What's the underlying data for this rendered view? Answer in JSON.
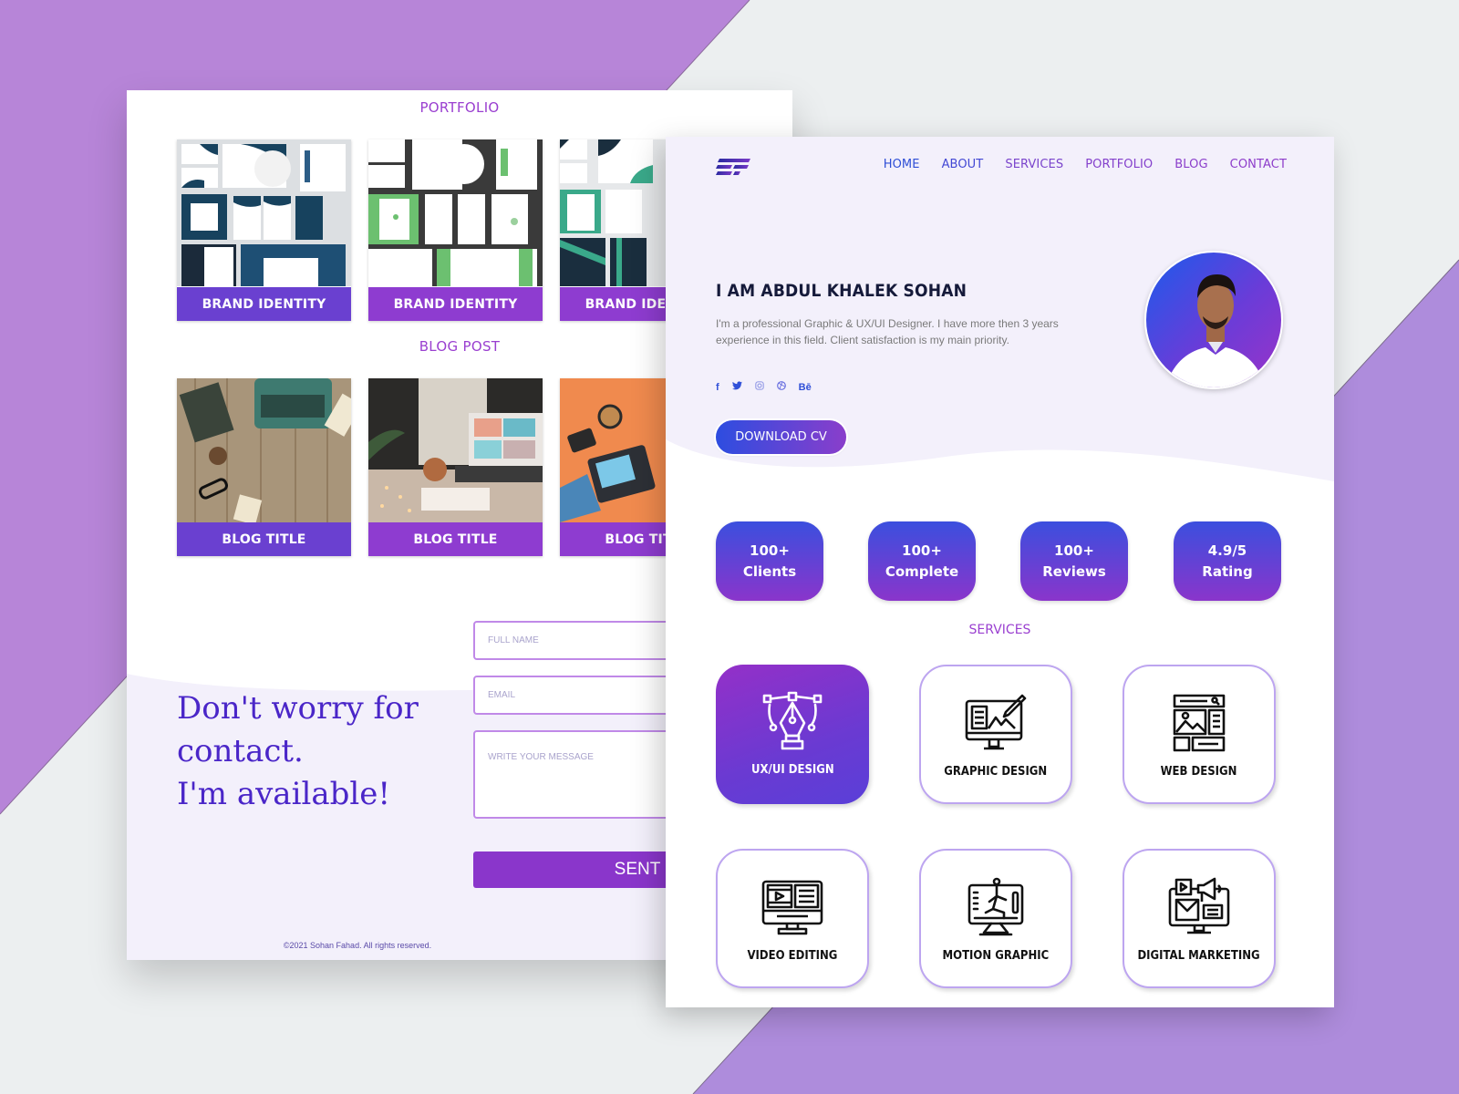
{
  "colors": {
    "background_purple": "#b785d8",
    "background_grey": "#eceff0",
    "accent_purple": "#8a36cb",
    "accent_blue": "#2d4de0",
    "heading_purple": "#9a3fd0",
    "contact_heading": "#4a26c8"
  },
  "left_page": {
    "portfolio": {
      "title": "PORTFOLIO",
      "items": [
        {
          "label": "BRAND IDENTITY",
          "image": "stationery-mockup-navy"
        },
        {
          "label": "BRAND IDENTITY",
          "image": "stationery-mockup-green"
        },
        {
          "label": "BRAND IDENTITY",
          "image": "stationery-mockup-teal"
        }
      ]
    },
    "blog": {
      "title": "BLOG POST",
      "items": [
        {
          "label": "BLOG TITLE",
          "image": "typewriter-desk-photo"
        },
        {
          "label": "BLOG TITLE",
          "image": "laptop-workspace-photo"
        },
        {
          "label": "BLOG TITLE",
          "image": "designer-tablet-illustration"
        }
      ]
    },
    "contact": {
      "heading_line1": "Don't worry for",
      "heading_line2": "contact.",
      "heading_line3": "I'm available!",
      "full_name_placeholder": "FULL NAME",
      "email_placeholder": "EMAIL",
      "message_placeholder": "WRITE YOUR MESSAGE",
      "submit_label": "SENT"
    },
    "footer": "©2021 Sohan Fahad. All rights reserved."
  },
  "right_page": {
    "logo": "SF",
    "nav": [
      {
        "label": "HOME",
        "color": "#2f4fd6"
      },
      {
        "label": "ABOUT",
        "color": "#4348d4"
      },
      {
        "label": "SERVICES",
        "color": "#7a44cc"
      },
      {
        "label": "PORTFOLIO",
        "color": "#8440cc"
      },
      {
        "label": "BLOG",
        "color": "#8a3ecb"
      },
      {
        "label": "CONTACT",
        "color": "#8d3cca"
      }
    ],
    "hero": {
      "name": "I AM ABDUL KHALEK SOHAN",
      "description": "I'm a professional Graphic & UX/UI Designer. I have more then 3 years experience in this field. Client satisfaction is my main priority.",
      "socials": [
        "facebook-icon",
        "twitter-icon",
        "instagram-icon",
        "dribbble-icon",
        "behance-icon"
      ],
      "social_glyphs": [
        "f",
        "🐦",
        "◎",
        "⊛",
        "Bē"
      ],
      "download_label": "DOWNLOAD CV"
    },
    "stats": [
      {
        "value": "100+",
        "label": "Clients"
      },
      {
        "value": "100+",
        "label": "Complete"
      },
      {
        "value": "100+",
        "label": "Reviews"
      },
      {
        "value": "4.9/5",
        "label": "Rating"
      }
    ],
    "services": {
      "title": "SERVICES",
      "items": [
        {
          "label": "UX/UI DESIGN",
          "icon": "pen-tool-icon",
          "active": true
        },
        {
          "label": "GRAPHIC DESIGN",
          "icon": "monitor-design-icon",
          "active": false
        },
        {
          "label": "WEB DESIGN",
          "icon": "web-layout-icon",
          "active": false
        },
        {
          "label": "VIDEO EDITING",
          "icon": "video-editing-icon",
          "active": false
        },
        {
          "label": "MOTION GRAPHIC",
          "icon": "motion-graphic-icon",
          "active": false
        },
        {
          "label": "DIGITAL MARKETING",
          "icon": "digital-marketing-icon",
          "active": false
        }
      ]
    }
  }
}
